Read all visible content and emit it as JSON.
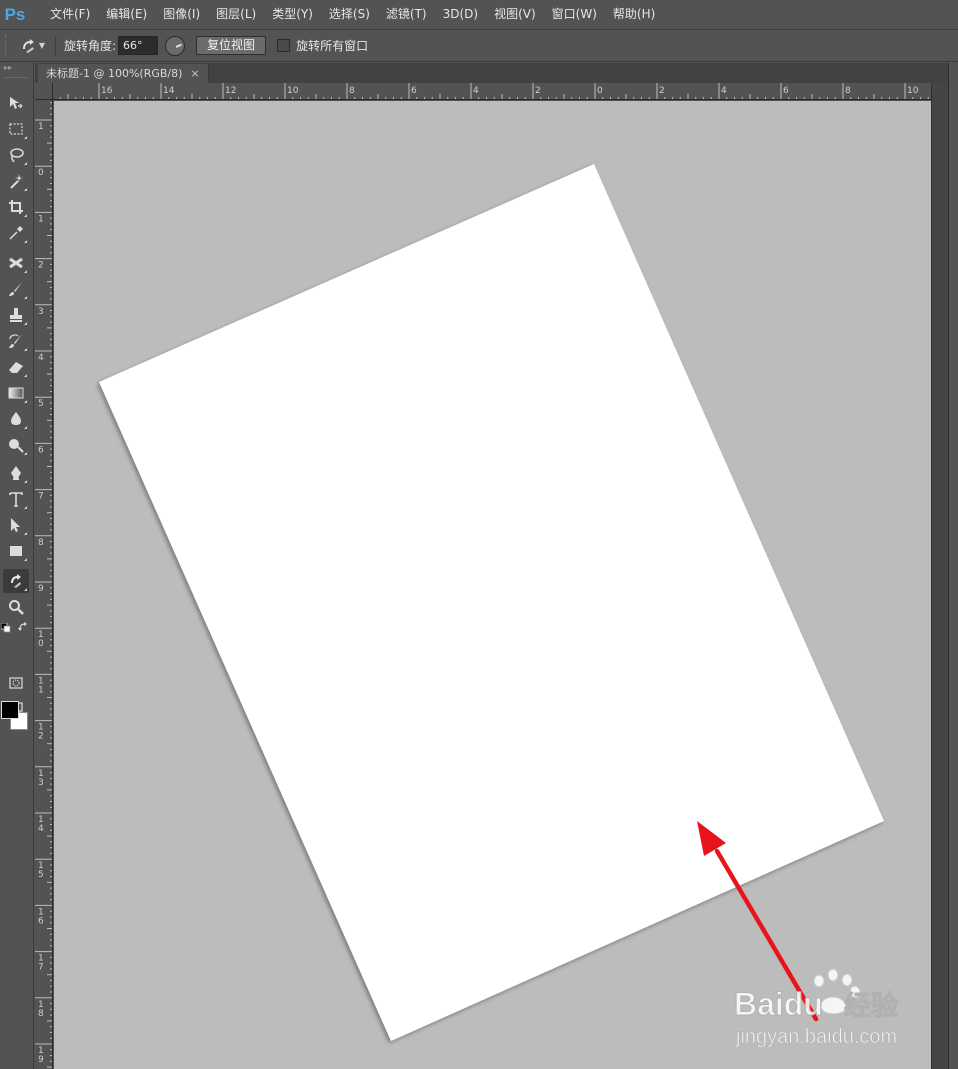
{
  "app": {
    "logo": "Ps"
  },
  "menu": {
    "items": [
      "文件(F)",
      "编辑(E)",
      "图像(I)",
      "图层(L)",
      "类型(Y)",
      "选择(S)",
      "滤镜(T)",
      "3D(D)",
      "视图(V)",
      "窗口(W)",
      "帮助(H)"
    ]
  },
  "options": {
    "tool_icon": "rotate-view-icon",
    "angle_label": "旋转角度:",
    "angle_value": "66°",
    "reset_view_label": "复位视图",
    "rotate_all_label": "旋转所有窗口",
    "rotate_all_checked": false
  },
  "document": {
    "tab_title": "未标题-1 @ 100%(RGB/8)",
    "close_glyph": "×",
    "rotation_degrees": 66
  },
  "rulers": {
    "horizontal_labels": [
      "16",
      "14",
      "12",
      "10",
      "8",
      "6",
      "4",
      "2",
      "0",
      "2",
      "4",
      "6",
      "8",
      "10"
    ],
    "vertical_labels": [
      "1",
      "0",
      "1",
      "2",
      "3",
      "4",
      "5",
      "6",
      "7",
      "8",
      "9",
      "10",
      "11",
      "12",
      "13",
      "14",
      "15",
      "16",
      "17",
      "18",
      "19"
    ]
  },
  "toolbar": {
    "tools": [
      "move-icon",
      "marquee-icon",
      "lasso-icon",
      "magic-wand-icon",
      "crop-icon",
      "eyedropper-icon",
      "healing-icon",
      "brush-icon",
      "stamp-icon",
      "history-brush-icon",
      "eraser-icon",
      "gradient-icon",
      "blur-icon",
      "dodge-icon",
      "pen-icon",
      "type-icon",
      "path-select-icon",
      "rectangle-icon",
      "rotate-view-icon",
      "zoom-icon",
      "quick-mask-icon",
      "screen-mode-icon"
    ],
    "active_tool": "rotate-view-icon",
    "foreground_color": "#000000",
    "background_color": "#ffffff"
  },
  "annotation": {
    "arrow_color": "#e8141b"
  },
  "watermark": {
    "brand": "Baidu",
    "product": "经验",
    "url": "jingyan.baidu.com"
  },
  "colors": {
    "canvas_bg": "#bcbcbc",
    "document": "#ffffff",
    "ui_bg": "#535353"
  }
}
